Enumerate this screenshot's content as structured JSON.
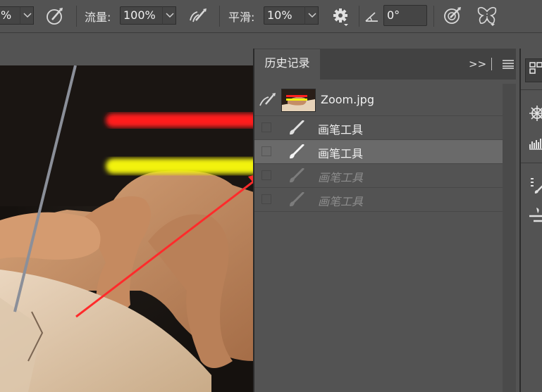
{
  "options_bar": {
    "opacity_value": "%",
    "flow_label": "流量:",
    "flow_value": "100%",
    "smoothing_label": "平滑:",
    "smoothing_value": "10%",
    "angle_value": "0°"
  },
  "history_panel": {
    "tab_label": "历史记录",
    "expand_label": ">>",
    "snapshot": {
      "label": "Zoom.jpg"
    },
    "states": [
      {
        "label": "画笔工具",
        "state": "normal"
      },
      {
        "label": "画笔工具",
        "state": "selected"
      },
      {
        "label": "画笔工具",
        "state": "disabled"
      },
      {
        "label": "画笔工具",
        "state": "disabled"
      }
    ]
  },
  "canvas": {
    "stroke_colors": [
      "#ff1a1a",
      "#f2f20a"
    ],
    "arrow_color": "#ff2b2b"
  }
}
